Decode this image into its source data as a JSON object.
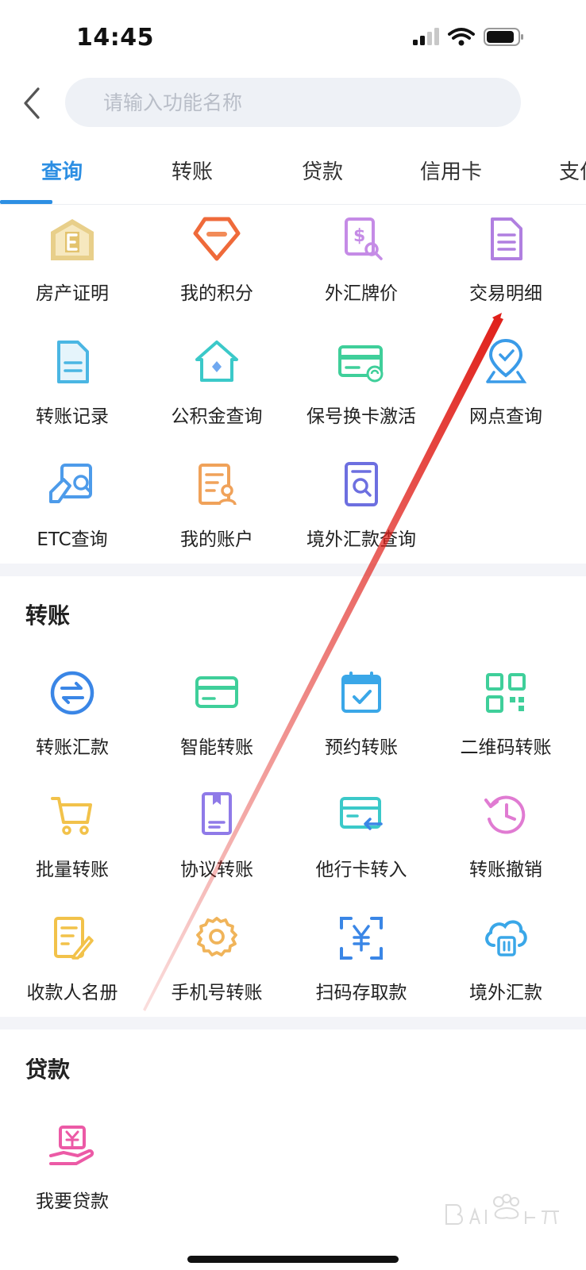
{
  "status_bar": {
    "time": "14:45"
  },
  "search": {
    "placeholder": "请输入功能名称"
  },
  "tabs": [
    {
      "label": "查询"
    },
    {
      "label": "转账"
    },
    {
      "label": "贷款"
    },
    {
      "label": "信用卡"
    },
    {
      "label": "支付"
    }
  ],
  "query_grid": [
    {
      "label": "房产证明",
      "icon": "house-certificate-icon"
    },
    {
      "label": "我的积分",
      "icon": "diamond-points-icon"
    },
    {
      "label": "外汇牌价",
      "icon": "exchange-rate-icon"
    },
    {
      "label": "交易明细",
      "icon": "transaction-detail-icon"
    },
    {
      "label": "转账记录",
      "icon": "transfer-record-icon"
    },
    {
      "label": "公积金查询",
      "icon": "housing-fund-icon"
    },
    {
      "label": "保号换卡激活",
      "icon": "card-activate-icon"
    },
    {
      "label": "网点查询",
      "icon": "branch-location-icon"
    },
    {
      "label": "ETC查询",
      "icon": "etc-search-icon"
    },
    {
      "label": "我的账户",
      "icon": "my-account-icon"
    },
    {
      "label": "境外汇款查询",
      "icon": "overseas-remit-search-icon"
    }
  ],
  "transfer_section": {
    "title": "转账",
    "items": [
      {
        "label": "转账汇款",
        "icon": "transfer-exchange-icon"
      },
      {
        "label": "智能转账",
        "icon": "smart-transfer-card-icon"
      },
      {
        "label": "预约转账",
        "icon": "scheduled-transfer-calendar-icon"
      },
      {
        "label": "二维码转账",
        "icon": "qr-code-icon"
      },
      {
        "label": "批量转账",
        "icon": "cart-icon"
      },
      {
        "label": "协议转账",
        "icon": "agreement-doc-icon"
      },
      {
        "label": "他行卡转入",
        "icon": "other-bank-card-icon"
      },
      {
        "label": "转账撤销",
        "icon": "undo-clock-icon"
      },
      {
        "label": "收款人名册",
        "icon": "payee-list-icon"
      },
      {
        "label": "手机号转账",
        "icon": "gear-icon"
      },
      {
        "label": "扫码存取款",
        "icon": "scan-yuan-icon"
      },
      {
        "label": "境外汇款",
        "icon": "cloud-remit-icon"
      }
    ]
  },
  "loan_section": {
    "title": "贷款",
    "items": [
      {
        "label": "我要贷款",
        "icon": "loan-hand-icon"
      }
    ]
  },
  "colors": {
    "accent": "#2d8fe3",
    "annotation": "#e0201a"
  }
}
